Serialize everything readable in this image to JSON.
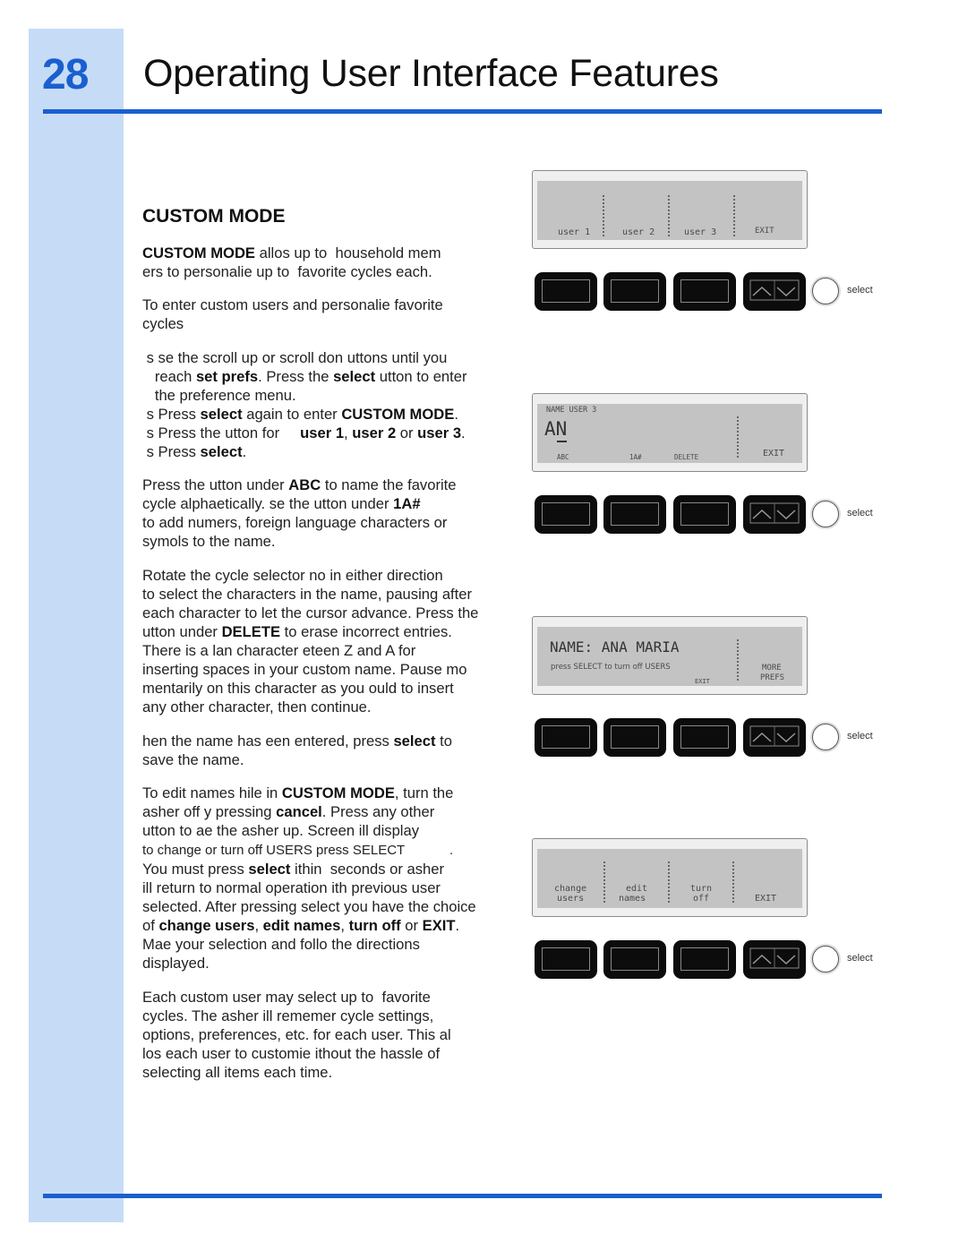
{
  "header": {
    "page_number": "28",
    "title": "Operating User Interface Features"
  },
  "main": {
    "heading": "CUSTOM MODE",
    "paragraphs": [
      {
        "lines": [
          [
            {
              "t": "CUSTOM MODE",
              "b": true
            },
            {
              "t": " allos up to  household mem"
            }
          ],
          [
            {
              "t": "ers to personalie up to  favorite cycles each."
            }
          ]
        ]
      },
      {
        "lines": [
          [
            {
              "t": "To enter custom users and personalie favorite"
            }
          ],
          [
            {
              "t": "cycles"
            }
          ]
        ]
      },
      {
        "lines": [
          [
            {
              "t": " s se the scroll up or scroll don uttons until you"
            }
          ],
          [
            {
              "t": "   reach "
            },
            {
              "t": "set prefs",
              "b": true
            },
            {
              "t": ". Press the "
            },
            {
              "t": "select",
              "b": true
            },
            {
              "t": " utton to enter"
            }
          ],
          [
            {
              "t": "   the preference menu."
            }
          ],
          [
            {
              "t": " s Press "
            },
            {
              "t": "select",
              "b": true
            },
            {
              "t": " again to enter "
            },
            {
              "t": "CUSTOM MODE",
              "b": true
            },
            {
              "t": "."
            }
          ],
          [
            {
              "t": " s Press the utton for     "
            },
            {
              "t": "user 1",
              "b": true
            },
            {
              "t": ", "
            },
            {
              "t": "user 2",
              "b": true
            },
            {
              "t": " or "
            },
            {
              "t": "user 3",
              "b": true
            },
            {
              "t": "."
            }
          ],
          [
            {
              "t": " s Press "
            },
            {
              "t": "select",
              "b": true
            },
            {
              "t": "."
            }
          ]
        ]
      },
      {
        "lines": [
          [
            {
              "t": "Press the utton under "
            },
            {
              "t": "ABC",
              "b": true
            },
            {
              "t": " to name the favorite"
            }
          ],
          [
            {
              "t": "cycle alphaetically. se the utton under "
            },
            {
              "t": "1A#",
              "b": true
            }
          ],
          [
            {
              "t": "to add numers, foreign language characters or"
            }
          ],
          [
            {
              "t": "symols to the name."
            }
          ]
        ]
      },
      {
        "lines": [
          [
            {
              "t": "Rotate the cycle selector no in either direction"
            }
          ],
          [
            {
              "t": "to select the characters in the name, pausing after"
            }
          ],
          [
            {
              "t": "each character to let the cursor advance. Press the"
            }
          ],
          [
            {
              "t": "utton under "
            },
            {
              "t": "DELETE",
              "b": true
            },
            {
              "t": " to erase incorrect entries."
            }
          ],
          [
            {
              "t": "There is a lan character eteen Z and A for"
            }
          ],
          [
            {
              "t": "inserting spaces in your custom name. Pause mo"
            }
          ],
          [
            {
              "t": "mentarily on this character as you ould to insert"
            }
          ],
          [
            {
              "t": "any other character, then continue."
            }
          ]
        ]
      },
      {
        "lines": [
          [
            {
              "t": "hen the name has een entered, press "
            },
            {
              "t": "select",
              "b": true
            },
            {
              "t": " to"
            }
          ],
          [
            {
              "t": "save the name."
            }
          ]
        ]
      },
      {
        "lines": [
          [
            {
              "t": "To edit names hile in "
            },
            {
              "t": "CUSTOM MODE",
              "b": true
            },
            {
              "t": ", turn the"
            }
          ],
          [
            {
              "t": "asher off y pressing "
            },
            {
              "t": "cancel",
              "b": true
            },
            {
              "t": ". Press any other"
            }
          ],
          [
            {
              "t": "utton to ae the asher up. Screen ill display"
            }
          ],
          [
            {
              "t": "to change or turn off USERS press SELECT            .",
              "s": true
            }
          ],
          [
            {
              "t": "You must press "
            },
            {
              "t": "select",
              "b": true
            },
            {
              "t": " ithin  seconds or asher"
            }
          ],
          [
            {
              "t": "ill return to normal operation ith previous user"
            }
          ],
          [
            {
              "t": "selected. After pressing select you have the choice"
            }
          ],
          [
            {
              "t": "of "
            },
            {
              "t": "change users",
              "b": true
            },
            {
              "t": ", "
            },
            {
              "t": "edit names",
              "b": true
            },
            {
              "t": ", "
            },
            {
              "t": "turn off",
              "b": true
            },
            {
              "t": " or "
            },
            {
              "t": "EXIT",
              "b": true
            },
            {
              "t": "."
            }
          ],
          [
            {
              "t": "Mae your selection and follo the directions"
            }
          ],
          [
            {
              "t": "displayed."
            }
          ]
        ]
      },
      {
        "lines": [
          [
            {
              "t": "Each custom user may select up to  favorite"
            }
          ],
          [
            {
              "t": "cycles. The asher ill rememer cycle settings,"
            }
          ],
          [
            {
              "t": "options, preferences, etc. for each user. This al"
            }
          ],
          [
            {
              "t": "los each user to customie ithout the hassle of"
            }
          ],
          [
            {
              "t": "selecting all items each time."
            }
          ]
        ]
      }
    ]
  },
  "displays": [
    {
      "labels": [
        "user 1",
        "user 2",
        "user 3",
        "EXIT"
      ]
    },
    {
      "title": "NAME USER 3",
      "entry": "AN",
      "labels": [
        "ABC",
        "1A#",
        "DELETE",
        "EXIT"
      ]
    },
    {
      "title": "NAME: ANA MARIA",
      "message": "press SELECT to turn off USERS",
      "labels": [
        "EXIT",
        "MORE",
        "PREFS"
      ]
    },
    {
      "labels": [
        "change",
        "users",
        "edit",
        "names",
        "turn",
        "off",
        "EXIT"
      ]
    }
  ],
  "controls": {
    "select_label": "select",
    "scroll_icons": [
      "scroll-up-icon",
      "scroll-down-icon"
    ]
  },
  "colors": {
    "accent": "#1a5fd0",
    "sidebar": "#c6dcf6",
    "lcd": "#c3c3c3"
  }
}
